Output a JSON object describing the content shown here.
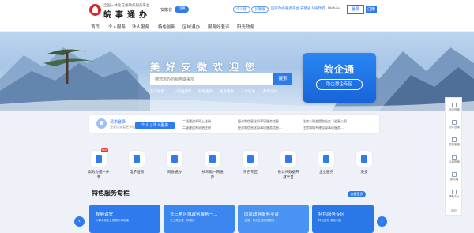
{
  "header": {
    "logo_subtitle": "全国一体化在线政务服务平台",
    "logo_title": "皖事通办",
    "region": "安徽省",
    "switch_label": "切换",
    "links": [
      "个人版",
      "长者版",
      "国家政务服务平台",
      "安徽省人民政府",
      "Mobile"
    ],
    "login": "登录",
    "register": "注册"
  },
  "nav": {
    "items": [
      "首页",
      "个人服务",
      "法人服务",
      "特色创新",
      "区域通办",
      "服务好差评",
      "阳光政务"
    ]
  },
  "hero": {
    "title": "美好安徽欢迎您",
    "search_placeholder": "搜您想办的服务或事项",
    "search_button": "搜索",
    "hot_words": [
      "热门搜索：",
      "公积金提取",
      "社保查询",
      "生育服务",
      "人才引进",
      "养老退休"
    ]
  },
  "promo": {
    "title": "皖企通",
    "button": "助企惠企专区"
  },
  "user_strip": {
    "name": "请求登录",
    "hint": "登录后查看更多服务",
    "tab": "个人 | 法人服务",
    "notices": [
      "二级建造师网上注册",
      "经济和信息化局事项服务信息...",
      "住房公积金提取业务（省直公积...",
      "二级建造师初始注册",
      "经济和信息化局事项服务信息...",
      "住房和城乡建设局事项服务..."
    ]
  },
  "services": [
    {
      "label": "高效办成一件事",
      "new": true
    },
    {
      "label": "电子证照"
    },
    {
      "label": "跨省通办"
    },
    {
      "label": "长三角一网通办"
    },
    {
      "label": "特色专区"
    },
    {
      "label": "省公共数据开放平台"
    },
    {
      "label": "企业服务"
    },
    {
      "label": "更多"
    }
  ],
  "new_badge": "NEW",
  "featured": {
    "title": "特色服务专栏",
    "more": "查看更多",
    "cards": [
      {
        "title": "视频课堂",
        "sub": "为群众和企业提供办事指南",
        "color": "#2f7bee"
      },
      {
        "title": "长三角区域政务服务一...",
        "sub": "长三角区域一网通办",
        "color": "#3b86ef"
      },
      {
        "title": "国家政务服务平台",
        "sub": "全国一体化在线政务服务",
        "color": "#4a93f2"
      },
      {
        "title": "特色服务专区",
        "sub": "特色服务 便民利民",
        "color": "#2a78e8"
      }
    ],
    "prev": "‹",
    "next": "›"
  },
  "rail": {
    "items": [
      "在线咨询",
      "办件查询",
      "智能客服",
      "办事指南",
      "移动端",
      "帮助中心"
    ],
    "top": "返回"
  }
}
